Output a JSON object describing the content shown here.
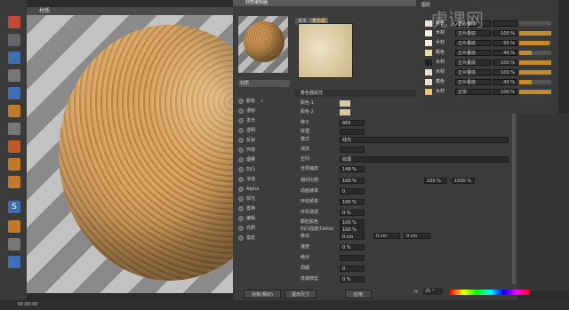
{
  "viewport": {
    "title": "材质"
  },
  "material_editor": {
    "title": "材质编辑器",
    "tabs": [
      "基本",
      "着色器"
    ],
    "section_title": "着色器属性",
    "channels": [
      {
        "label": "颜色",
        "checked": true
      },
      {
        "label": "漫射",
        "checked": false
      },
      {
        "label": "发光",
        "checked": false
      },
      {
        "label": "透明",
        "checked": false
      },
      {
        "label": "反射",
        "checked": false
      },
      {
        "label": "环境",
        "checked": false
      },
      {
        "label": "烟雾",
        "checked": false
      },
      {
        "label": "凹凸",
        "checked": false
      },
      {
        "label": "法线",
        "checked": false
      },
      {
        "label": "Alpha",
        "checked": false
      },
      {
        "label": "辉光",
        "checked": false
      },
      {
        "label": "置换",
        "checked": false
      },
      {
        "label": "编辑",
        "checked": false
      },
      {
        "label": "光照",
        "checked": false
      },
      {
        "label": "指定",
        "checked": false
      }
    ],
    "props": [
      {
        "label": "颜色 1",
        "value": ""
      },
      {
        "label": "颜色 2",
        "value": ""
      },
      {
        "label": "种子",
        "value": "665"
      },
      {
        "label": "纹理",
        "value": ""
      },
      {
        "label": "模式",
        "value": "线光"
      },
      {
        "label": "湍流",
        "value": ""
      },
      {
        "label": "空间",
        "value": "纹理"
      },
      {
        "label": "全局缩放",
        "value": "149 %"
      },
      {
        "label": "相对比例",
        "value": "100 %"
      },
      {
        "label": "动画速率",
        "value": "0"
      },
      {
        "label": "环纹频率",
        "value": "100 %"
      },
      {
        "label": "环纹湍流",
        "value": "0 %"
      },
      {
        "label": "颗粒颜色",
        "value": "100 %"
      },
      {
        "label": "凹凸强度(Delta)",
        "value": "100 %"
      },
      {
        "label": "移动",
        "value": "0 cm"
      },
      {
        "label": "速度",
        "value": "0 %"
      },
      {
        "label": "绝对",
        "value": ""
      },
      {
        "label": "周期",
        "value": "0"
      },
      {
        "label": "低端修剪",
        "value": "0 %"
      }
    ],
    "bottom_buttons": [
      "对象(相对)",
      "显示尺寸",
      "应用"
    ],
    "rel_scale_extra": [
      "100 %",
      "1500 %"
    ],
    "move_extra": [
      "0 cm",
      "0 cm"
    ]
  },
  "layers_panel": {
    "title": "图层",
    "rows": [
      {
        "name": "颜色",
        "mode": "正片叠底",
        "pct": "",
        "fill": 0,
        "thumb": "#e8e0d0"
      },
      {
        "name": "木材",
        "mode": "正片叠底",
        "pct": "100 %",
        "fill": 1,
        "thumb": "#f2ede2"
      },
      {
        "name": "木材",
        "mode": "正片叠底",
        "pct": "95 %",
        "fill": 0.95,
        "thumb": "#f2ede2"
      },
      {
        "name": "颜色",
        "mode": "正片叠底",
        "pct": "40 %",
        "fill": 0.4,
        "thumb": "#ecd7ae"
      },
      {
        "name": "木材",
        "mode": "正片叠底",
        "pct": "100 %",
        "fill": 1,
        "thumb": "#222222"
      },
      {
        "name": "木材",
        "mode": "正片叠底",
        "pct": "100 %",
        "fill": 1,
        "thumb": "#e8e0d0"
      },
      {
        "name": "着色",
        "mode": "正片叠底",
        "pct": "40 %",
        "fill": 0.4,
        "thumb": "#e8e0d0"
      },
      {
        "name": "木材",
        "mode": "正常",
        "pct": "100 %",
        "fill": 1,
        "thumb": "#e6c080"
      }
    ]
  },
  "color_bar": {
    "label": "H",
    "value": "25 °"
  },
  "status": {
    "time": "00:00:00"
  },
  "watermark": "虎课网"
}
